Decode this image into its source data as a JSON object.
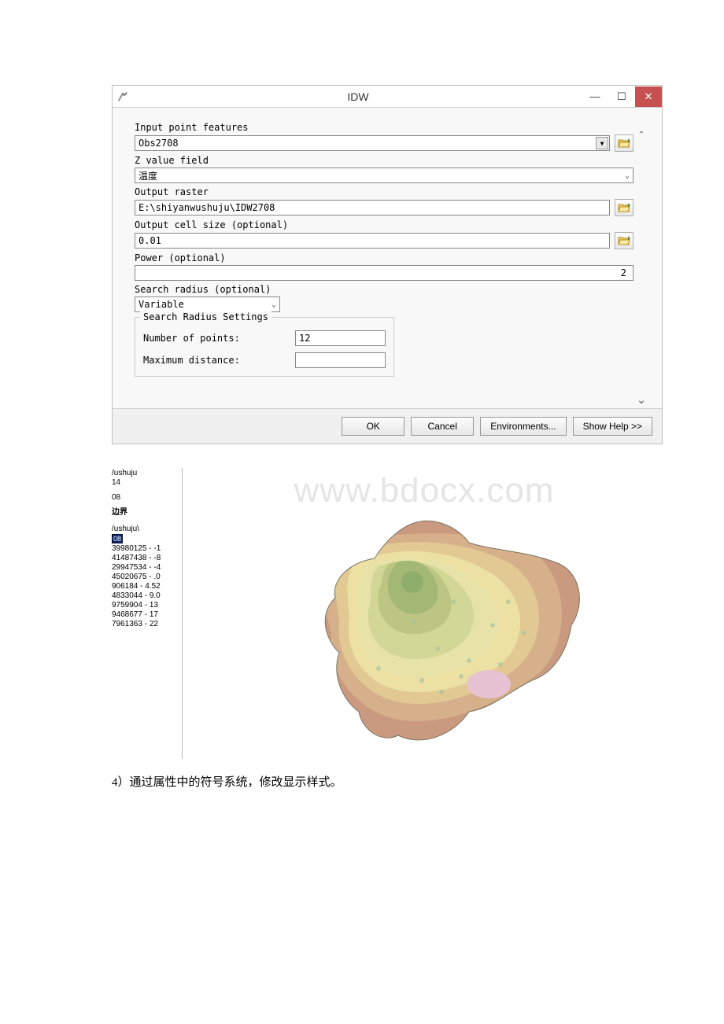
{
  "dialog": {
    "title": "IDW",
    "input_point_label": "Input point features",
    "input_point_value": "Obs2708",
    "zvalue_label": "Z value field",
    "zvalue_value": "温度",
    "output_raster_label": "Output raster",
    "output_raster_value": "E:\\shiyanwushuju\\IDW2708",
    "cellsize_label": "Output cell size (optional)",
    "cellsize_value": "0.01",
    "power_label": "Power (optional)",
    "power_value": "2",
    "searchradius_label": "Search radius (optional)",
    "searchradius_value": "Variable",
    "fieldset_legend": "Search Radius Settings",
    "numpoints_label": "Number of points:",
    "numpoints_value": "12",
    "maxdist_label": "Maximum distance:",
    "maxdist_value": "",
    "buttons": {
      "ok": "OK",
      "cancel": "Cancel",
      "env": "Environments...",
      "help": "Show Help >>"
    }
  },
  "toc": {
    "l1": "/ushuju",
    "l2": "14",
    "l3": "08",
    "l4": "边界",
    "l5": "/ushuju\\",
    "sel": "08",
    "classes": [
      "39980125 - -1",
      "41487438 - -8",
      "29947534 - -4",
      "45020675 - .0",
      "906184 - 4.52",
      "4833044 - 9.0",
      "9759904 - 13",
      "9468677 - 17",
      "7961363 - 22"
    ]
  },
  "watermark": "www.bdocx.com",
  "footnote": "4）通过属性中的符号系统，修改显示样式。"
}
